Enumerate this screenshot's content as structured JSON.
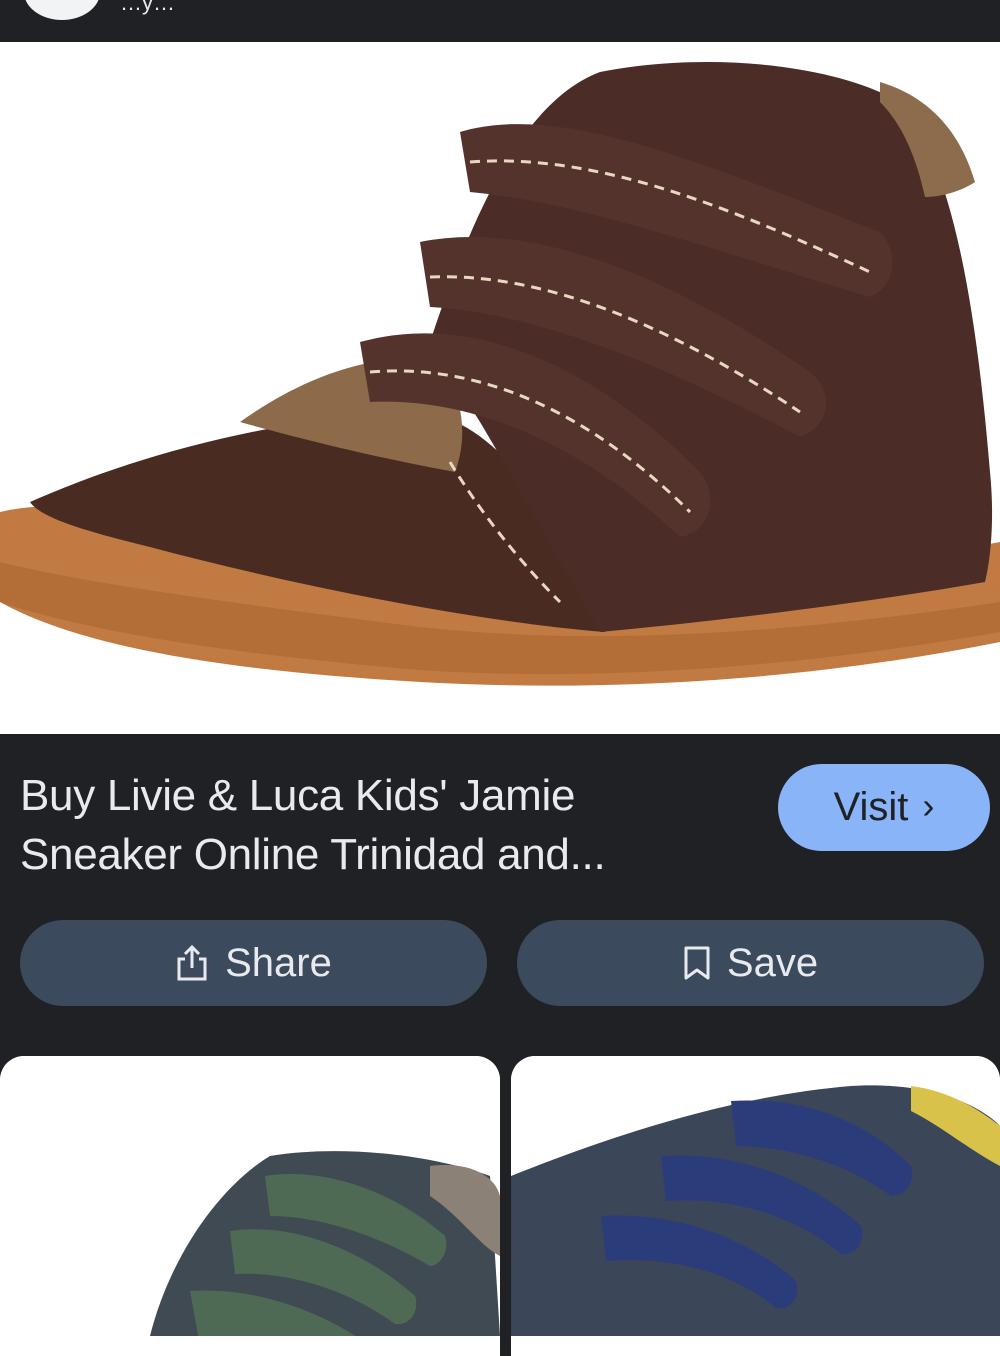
{
  "header": {
    "partial_text": "…y…"
  },
  "result": {
    "title": "Buy Livie & Luca Kids' Jamie Sneaker Online Trinidad and...",
    "visit_label": "Visit",
    "visit_icon": "chevron-right-icon"
  },
  "actions": {
    "share_label": "Share",
    "share_icon": "share-icon",
    "save_label": "Save",
    "save_icon": "bookmark-icon"
  },
  "colors": {
    "background": "#202124",
    "visit_button": "#8ab4f8",
    "action_button": "#3c4a5e",
    "text": "#e8eaed"
  },
  "related": [
    {
      "image": "green-velcro-high-top-shoe"
    },
    {
      "image": "navy-velcro-sneaker"
    }
  ]
}
